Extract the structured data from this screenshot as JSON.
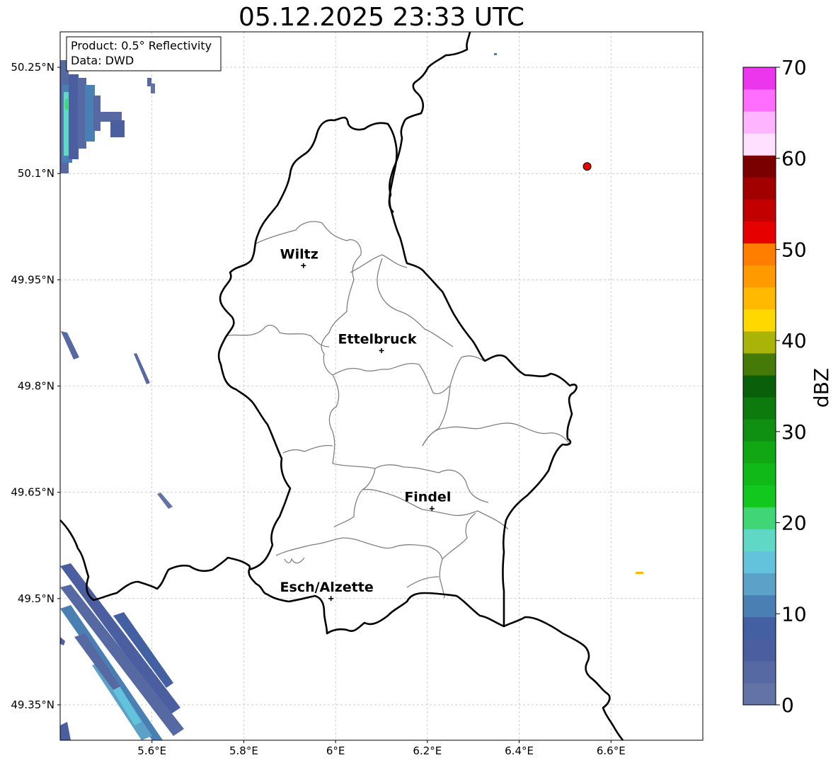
{
  "title": "05.12.2025 23:33 UTC",
  "info_box": {
    "product": "Product: 0.5° Reflectivity",
    "data": "Data: DWD"
  },
  "lon_ticks": [
    {
      "lon": 5.6,
      "label": "5.6°E"
    },
    {
      "lon": 5.8,
      "label": "5.8°E"
    },
    {
      "lon": 6.0,
      "label": "6°E"
    },
    {
      "lon": 6.2,
      "label": "6.2°E"
    },
    {
      "lon": 6.4,
      "label": "6.4°E"
    },
    {
      "lon": 6.6,
      "label": "6.6°E"
    }
  ],
  "lat_ticks": [
    {
      "lat": 50.25,
      "label": "50.25°N"
    },
    {
      "lat": 50.1,
      "label": "50.1°N"
    },
    {
      "lat": 49.95,
      "label": "49.95°N"
    },
    {
      "lat": 49.8,
      "label": "49.8°N"
    },
    {
      "lat": 49.65,
      "label": "49.65°N"
    },
    {
      "lat": 49.5,
      "label": "49.5°N"
    },
    {
      "lat": 49.35,
      "label": "49.35°N"
    }
  ],
  "map_extent": {
    "lon_min": 5.4,
    "lon_max": 6.8,
    "lat_min": 49.3,
    "lat_max": 50.3
  },
  "cities": [
    {
      "name": "Wiltz",
      "lon": 5.93,
      "lat": 49.97
    },
    {
      "name": "Ettelbruck",
      "lon": 6.1,
      "lat": 49.85
    },
    {
      "name": "Findel",
      "lon": 6.21,
      "lat": 49.627
    },
    {
      "name": "Esch/Alzette",
      "lon": 5.99,
      "lat": 49.5
    }
  ],
  "radar_site": {
    "lon": 6.548,
    "lat": 50.11,
    "color": "#e60000"
  },
  "colorbar": {
    "label": "dBZ",
    "min": 0,
    "max": 70,
    "tick_values": [
      0,
      10,
      20,
      30,
      40,
      50,
      60,
      70
    ],
    "tick_labels": [
      "0",
      "10",
      "20",
      "30",
      "40",
      "50",
      "60",
      "70"
    ],
    "colors": [
      "#6373a7",
      "#5769a3",
      "#4a5ea0",
      "#4360a2",
      "#4a7fb4",
      "#5ca2c8",
      "#63c3dc",
      "#5fd8c6",
      "#40d678",
      "#12c81e",
      "#10b818",
      "#10a614",
      "#0f9012",
      "#0d7a0e",
      "#0a600a",
      "#457a08",
      "#aab408",
      "#ffd800",
      "#ffba00",
      "#ff9a00",
      "#ff7e00",
      "#e60000",
      "#c20000",
      "#a20000",
      "#7a0000",
      "#ffe0ff",
      "#ffb4ff",
      "#ff6eff",
      "#ec36ee"
    ]
  }
}
